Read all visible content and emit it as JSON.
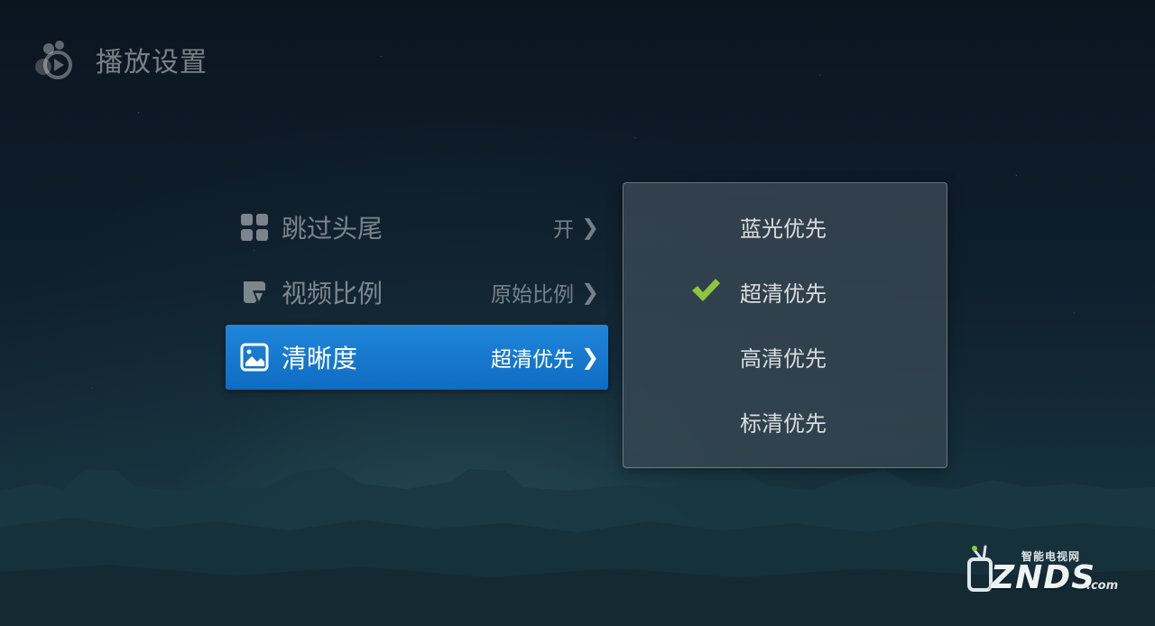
{
  "header": {
    "title": "播放设置",
    "logo_icon": "player-logo-icon"
  },
  "menu": {
    "items": [
      {
        "label": "跳过头尾",
        "value": "开",
        "icon": "grid-icon",
        "active": false
      },
      {
        "label": "视频比例",
        "value": "原始比例",
        "icon": "aspect-ratio-icon",
        "active": false
      },
      {
        "label": "清晰度",
        "value": "超清优先",
        "icon": "image-quality-icon",
        "active": true
      }
    ],
    "chevron": "❯"
  },
  "options_panel": {
    "options": [
      {
        "label": "蓝光优先",
        "selected": false
      },
      {
        "label": "超清优先",
        "selected": true
      },
      {
        "label": "高清优先",
        "selected": false
      },
      {
        "label": "标清优先",
        "selected": false
      }
    ]
  },
  "watermark": {
    "subtitle": "智能电视网",
    "brand": "ZNDS",
    "tld": ".com"
  },
  "colors": {
    "accent_blue": "#1379d0",
    "check_green": "#8cc63f",
    "background": "#0f1f2d"
  }
}
